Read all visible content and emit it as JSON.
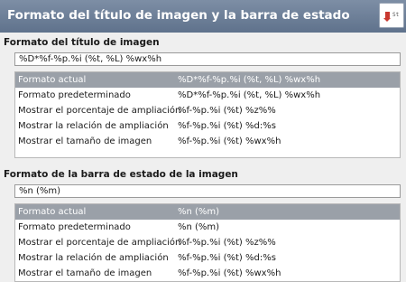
{
  "header": {
    "title": "Formato del título de imagen y la barra de estado",
    "icon": "status-bar-format-icon"
  },
  "title_section": {
    "heading": "Formato del título de imagen",
    "entry_value": "%D*%f-%p.%i (%t, %L) %wx%h",
    "rows": [
      {
        "name": "Formato actual",
        "format": "%D*%f-%p.%i (%t, %L) %wx%h"
      },
      {
        "name": "Formato predeterminado",
        "format": "%D*%f-%p.%i (%t, %L) %wx%h"
      },
      {
        "name": "Mostrar el porcentaje de ampliación",
        "format": "%f-%p.%i (%t) %z%%"
      },
      {
        "name": "Mostrar la relación de ampliación",
        "format": "%f-%p.%i (%t) %d:%s"
      },
      {
        "name": "Mostrar el tamaño de imagen",
        "format": "%f-%p.%i (%t) %wx%h"
      }
    ]
  },
  "status_section": {
    "heading": "Formato de la barra de estado de la imagen",
    "entry_value": "%n (%m)",
    "rows": [
      {
        "name": "Formato actual",
        "format": "%n (%m)"
      },
      {
        "name": "Formato predeterminado",
        "format": "%n (%m)"
      },
      {
        "name": "Mostrar el porcentaje de ampliación",
        "format": "%f-%p.%i (%t) %z%%"
      },
      {
        "name": "Mostrar la relación de ampliación",
        "format": "%f-%p.%i (%t) %d:%s"
      },
      {
        "name": "Mostrar el tamaño de imagen",
        "format": "%f-%p.%i (%t) %wx%h"
      }
    ]
  },
  "colors": {
    "header_bg": "#6b7d96",
    "selected_row_bg": "#9aa0a8"
  }
}
